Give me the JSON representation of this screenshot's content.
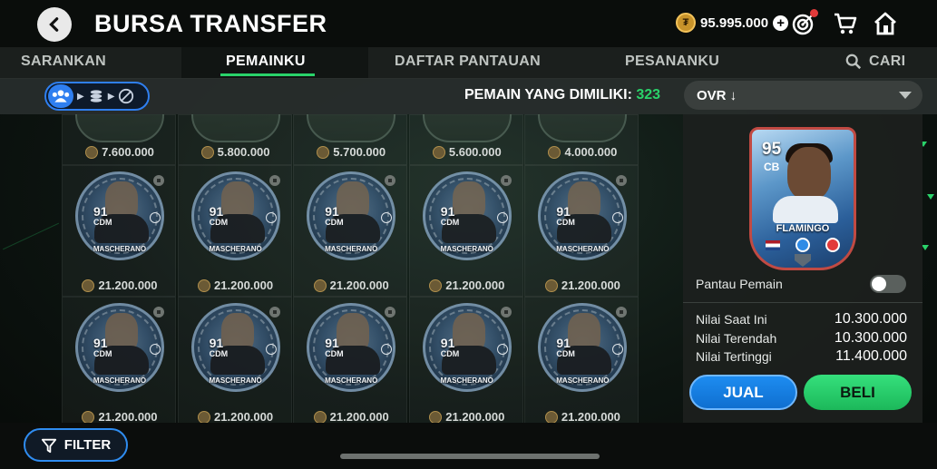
{
  "header": {
    "title": "BURSA TRANSFER",
    "coins": "95.995.000"
  },
  "tabs": [
    {
      "label": "SARANKAN",
      "active": false
    },
    {
      "label": "PEMAINKU",
      "active": true
    },
    {
      "label": "DAFTAR PANTAUAN",
      "active": false
    },
    {
      "label": "PESANANKU",
      "active": false
    },
    {
      "label": "CARI",
      "active": false
    }
  ],
  "subbar": {
    "owned_label": "PEMAIN YANG DIMILIKI:",
    "owned_count": "323",
    "sort_label": "OVR ↓"
  },
  "grid": {
    "top_row_prices": [
      "7.600.000",
      "5.800.000",
      "5.700.000",
      "5.600.000",
      "4.000.000"
    ],
    "rows": [
      [
        {
          "rating": "91",
          "pos": "CDM",
          "name": "MASCHERANO",
          "price": "21.200.000"
        },
        {
          "rating": "91",
          "pos": "CDM",
          "name": "MASCHERANO",
          "price": "21.200.000"
        },
        {
          "rating": "91",
          "pos": "CDM",
          "name": "MASCHERANO",
          "price": "21.200.000"
        },
        {
          "rating": "91",
          "pos": "CDM",
          "name": "MASCHERANO",
          "price": "21.200.000"
        },
        {
          "rating": "91",
          "pos": "CDM",
          "name": "MASCHERANO",
          "price": "21.200.000"
        }
      ],
      [
        {
          "rating": "91",
          "pos": "CDM",
          "name": "MASCHERANO",
          "price": "21.200.000"
        },
        {
          "rating": "91",
          "pos": "CDM",
          "name": "MASCHERANO",
          "price": "21.200.000"
        },
        {
          "rating": "91",
          "pos": "CDM",
          "name": "MASCHERANO",
          "price": "21.200.000"
        },
        {
          "rating": "91",
          "pos": "CDM",
          "name": "MASCHERANO",
          "price": "21.200.000"
        },
        {
          "rating": "91",
          "pos": "CDM",
          "name": "MASCHERANO",
          "price": "21.200.000"
        }
      ]
    ]
  },
  "selected_player": {
    "rating": "95",
    "position": "CB",
    "name": "FLAMINGO",
    "watch_label": "Pantau Pemain",
    "watch_on": false,
    "values": [
      {
        "label": "Nilai Saat Ini",
        "value": "10.300.000"
      },
      {
        "label": "Nilai Terendah",
        "value": "10.300.000"
      },
      {
        "label": "Nilai Tertinggi",
        "value": "11.400.000"
      }
    ]
  },
  "actions": {
    "sell_label": "JUAL",
    "buy_label": "BELI",
    "filter_label": "FILTER"
  },
  "colors": {
    "accent_green": "#2ad36a",
    "accent_blue": "#2f7ff0"
  },
  "icons": {
    "back": "chevron-left-icon",
    "coin": "coin-icon",
    "add": "plus-icon",
    "objectives": "target-icon",
    "store": "cart-icon",
    "home": "home-icon",
    "search": "search-icon",
    "filter": "filter-icon"
  }
}
